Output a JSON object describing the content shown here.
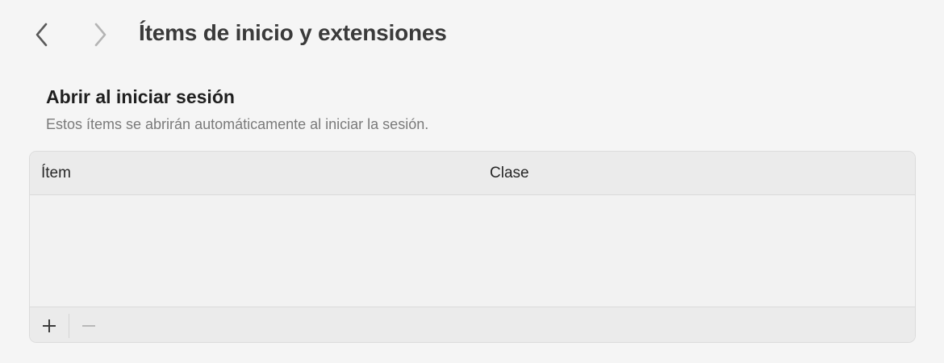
{
  "window": {
    "title": "Ítems de inicio y extensiones"
  },
  "section": {
    "title": "Abrir al iniciar sesión",
    "subtitle": "Estos ítems se abrirán automáticamente al iniciar la sesión."
  },
  "table": {
    "columns": [
      "Ítem",
      "Clase"
    ],
    "rows": []
  },
  "icons": {
    "back": "chevron-left-icon",
    "forward": "chevron-right-icon",
    "add": "plus-icon",
    "remove": "minus-icon"
  },
  "colors": {
    "background": "#f5f5f5",
    "table_header": "#ebebeb",
    "table_body": "#f2f2f2",
    "border": "#dcdcdc",
    "text_primary": "#222222",
    "text_secondary": "#7a7a7a",
    "disabled_icon": "#b8b8b8"
  }
}
